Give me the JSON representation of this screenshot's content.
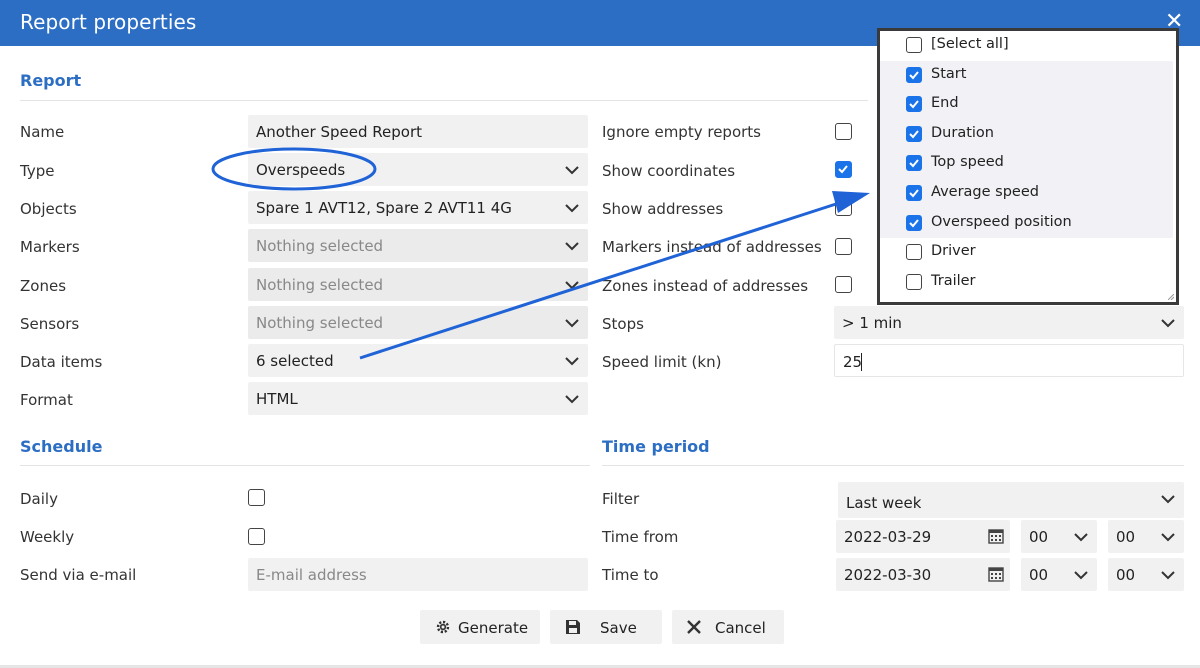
{
  "window": {
    "title": "Report properties"
  },
  "sections": {
    "report": "Report",
    "schedule": "Schedule",
    "time_period": "Time period"
  },
  "report": {
    "name": {
      "label": "Name",
      "value": "Another Speed Report"
    },
    "type": {
      "label": "Type",
      "value": "Overspeeds"
    },
    "objects": {
      "label": "Objects",
      "value": "Spare 1 AVT12, Spare 2 AVT11 4G"
    },
    "markers": {
      "label": "Markers",
      "value": "Nothing selected"
    },
    "zones": {
      "label": "Zones",
      "value": "Nothing selected"
    },
    "sensors": {
      "label": "Sensors",
      "value": "Nothing selected"
    },
    "data_items": {
      "label": "Data items",
      "value": "6 selected"
    },
    "format": {
      "label": "Format",
      "value": "HTML"
    }
  },
  "options": {
    "ignore_empty": {
      "label": "Ignore empty reports",
      "checked": false
    },
    "show_coordinates": {
      "label": "Show coordinates",
      "checked": true
    },
    "show_addresses": {
      "label": "Show addresses",
      "checked": false
    },
    "markers_instead": {
      "label": "Markers instead of addresses",
      "checked": false
    },
    "zones_instead": {
      "label": "Zones instead of addresses",
      "checked": false
    },
    "stops": {
      "label": "Stops",
      "value": "> 1 min"
    },
    "speed_limit": {
      "label": "Speed limit (kn)",
      "value": "25"
    }
  },
  "schedule": {
    "daily": {
      "label": "Daily",
      "checked": false
    },
    "weekly": {
      "label": "Weekly",
      "checked": false
    },
    "email": {
      "label": "Send via e-mail",
      "placeholder": "E-mail address"
    }
  },
  "time_period": {
    "filter": {
      "label": "Filter",
      "value": "Last week"
    },
    "time_from": {
      "label": "Time from",
      "date": "2022-03-29",
      "hour": "00",
      "minute": "00"
    },
    "time_to": {
      "label": "Time to",
      "date": "2022-03-30",
      "hour": "00",
      "minute": "00"
    }
  },
  "buttons": {
    "generate": "Generate",
    "save": "Save",
    "cancel": "Cancel"
  },
  "data_items_dropdown": {
    "items": [
      {
        "label": "[Select all]",
        "checked": false
      },
      {
        "label": "Start",
        "checked": true
      },
      {
        "label": "End",
        "checked": true
      },
      {
        "label": "Duration",
        "checked": true
      },
      {
        "label": "Top speed",
        "checked": true
      },
      {
        "label": "Average speed",
        "checked": true
      },
      {
        "label": "Overspeed position",
        "checked": true
      },
      {
        "label": "Driver",
        "checked": false
      },
      {
        "label": "Trailer",
        "checked": false
      }
    ]
  },
  "colors": {
    "titlebar": "#2c6ec4",
    "accent": "#1a73e8",
    "annotation": "#1f63d6"
  },
  "icons": [
    "close-icon",
    "chevron-down-icon",
    "calendar-icon",
    "gear-icon",
    "save-icon",
    "cancel-icon",
    "check-icon"
  ]
}
